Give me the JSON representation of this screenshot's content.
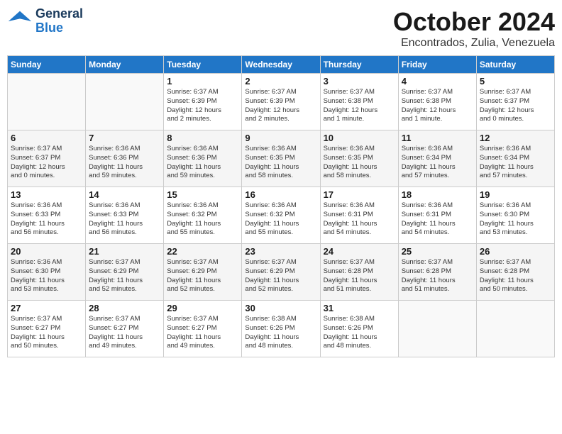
{
  "header": {
    "logo_general": "General",
    "logo_blue": "Blue",
    "month": "October 2024",
    "location": "Encontrados, Zulia, Venezuela"
  },
  "weekdays": [
    "Sunday",
    "Monday",
    "Tuesday",
    "Wednesday",
    "Thursday",
    "Friday",
    "Saturday"
  ],
  "weeks": [
    [
      {
        "day": "",
        "info": ""
      },
      {
        "day": "",
        "info": ""
      },
      {
        "day": "1",
        "info": "Sunrise: 6:37 AM\nSunset: 6:39 PM\nDaylight: 12 hours\nand 2 minutes."
      },
      {
        "day": "2",
        "info": "Sunrise: 6:37 AM\nSunset: 6:39 PM\nDaylight: 12 hours\nand 2 minutes."
      },
      {
        "day": "3",
        "info": "Sunrise: 6:37 AM\nSunset: 6:38 PM\nDaylight: 12 hours\nand 1 minute."
      },
      {
        "day": "4",
        "info": "Sunrise: 6:37 AM\nSunset: 6:38 PM\nDaylight: 12 hours\nand 1 minute."
      },
      {
        "day": "5",
        "info": "Sunrise: 6:37 AM\nSunset: 6:37 PM\nDaylight: 12 hours\nand 0 minutes."
      }
    ],
    [
      {
        "day": "6",
        "info": "Sunrise: 6:37 AM\nSunset: 6:37 PM\nDaylight: 12 hours\nand 0 minutes."
      },
      {
        "day": "7",
        "info": "Sunrise: 6:36 AM\nSunset: 6:36 PM\nDaylight: 11 hours\nand 59 minutes."
      },
      {
        "day": "8",
        "info": "Sunrise: 6:36 AM\nSunset: 6:36 PM\nDaylight: 11 hours\nand 59 minutes."
      },
      {
        "day": "9",
        "info": "Sunrise: 6:36 AM\nSunset: 6:35 PM\nDaylight: 11 hours\nand 58 minutes."
      },
      {
        "day": "10",
        "info": "Sunrise: 6:36 AM\nSunset: 6:35 PM\nDaylight: 11 hours\nand 58 minutes."
      },
      {
        "day": "11",
        "info": "Sunrise: 6:36 AM\nSunset: 6:34 PM\nDaylight: 11 hours\nand 57 minutes."
      },
      {
        "day": "12",
        "info": "Sunrise: 6:36 AM\nSunset: 6:34 PM\nDaylight: 11 hours\nand 57 minutes."
      }
    ],
    [
      {
        "day": "13",
        "info": "Sunrise: 6:36 AM\nSunset: 6:33 PM\nDaylight: 11 hours\nand 56 minutes."
      },
      {
        "day": "14",
        "info": "Sunrise: 6:36 AM\nSunset: 6:33 PM\nDaylight: 11 hours\nand 56 minutes."
      },
      {
        "day": "15",
        "info": "Sunrise: 6:36 AM\nSunset: 6:32 PM\nDaylight: 11 hours\nand 55 minutes."
      },
      {
        "day": "16",
        "info": "Sunrise: 6:36 AM\nSunset: 6:32 PM\nDaylight: 11 hours\nand 55 minutes."
      },
      {
        "day": "17",
        "info": "Sunrise: 6:36 AM\nSunset: 6:31 PM\nDaylight: 11 hours\nand 54 minutes."
      },
      {
        "day": "18",
        "info": "Sunrise: 6:36 AM\nSunset: 6:31 PM\nDaylight: 11 hours\nand 54 minutes."
      },
      {
        "day": "19",
        "info": "Sunrise: 6:36 AM\nSunset: 6:30 PM\nDaylight: 11 hours\nand 53 minutes."
      }
    ],
    [
      {
        "day": "20",
        "info": "Sunrise: 6:36 AM\nSunset: 6:30 PM\nDaylight: 11 hours\nand 53 minutes."
      },
      {
        "day": "21",
        "info": "Sunrise: 6:37 AM\nSunset: 6:29 PM\nDaylight: 11 hours\nand 52 minutes."
      },
      {
        "day": "22",
        "info": "Sunrise: 6:37 AM\nSunset: 6:29 PM\nDaylight: 11 hours\nand 52 minutes."
      },
      {
        "day": "23",
        "info": "Sunrise: 6:37 AM\nSunset: 6:29 PM\nDaylight: 11 hours\nand 52 minutes."
      },
      {
        "day": "24",
        "info": "Sunrise: 6:37 AM\nSunset: 6:28 PM\nDaylight: 11 hours\nand 51 minutes."
      },
      {
        "day": "25",
        "info": "Sunrise: 6:37 AM\nSunset: 6:28 PM\nDaylight: 11 hours\nand 51 minutes."
      },
      {
        "day": "26",
        "info": "Sunrise: 6:37 AM\nSunset: 6:28 PM\nDaylight: 11 hours\nand 50 minutes."
      }
    ],
    [
      {
        "day": "27",
        "info": "Sunrise: 6:37 AM\nSunset: 6:27 PM\nDaylight: 11 hours\nand 50 minutes."
      },
      {
        "day": "28",
        "info": "Sunrise: 6:37 AM\nSunset: 6:27 PM\nDaylight: 11 hours\nand 49 minutes."
      },
      {
        "day": "29",
        "info": "Sunrise: 6:37 AM\nSunset: 6:27 PM\nDaylight: 11 hours\nand 49 minutes."
      },
      {
        "day": "30",
        "info": "Sunrise: 6:38 AM\nSunset: 6:26 PM\nDaylight: 11 hours\nand 48 minutes."
      },
      {
        "day": "31",
        "info": "Sunrise: 6:38 AM\nSunset: 6:26 PM\nDaylight: 11 hours\nand 48 minutes."
      },
      {
        "day": "",
        "info": ""
      },
      {
        "day": "",
        "info": ""
      }
    ]
  ]
}
